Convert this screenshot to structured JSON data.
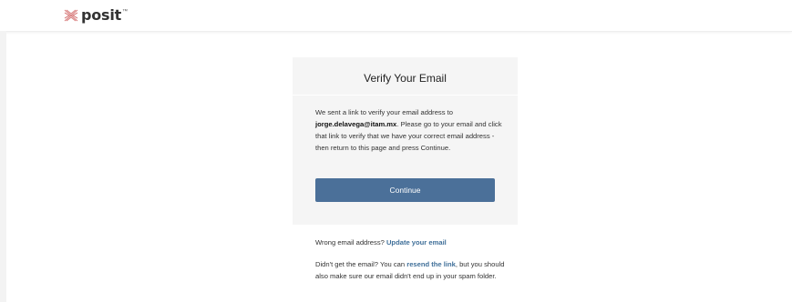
{
  "header": {
    "logo_text": "posit",
    "logo_mark": "™"
  },
  "card": {
    "title": "Verify Your Email",
    "body_prefix": "We sent a link to verify your email address to ",
    "email": "jorge.delavega@itam.mx",
    "body_suffix": ". Please go to your email and click that link to verify that we have your correct email address - then return to this page and press Continue.",
    "continue_label": "Continue"
  },
  "wrong_email": {
    "text": "Wrong email address? ",
    "link_label": "Update your email"
  },
  "resend": {
    "text_before": "Didn't get the email? You can ",
    "link_label": "resend the link",
    "text_after": ", but you should also make sure our email didn't end up in your spam folder."
  },
  "colors": {
    "button": "#4b7099",
    "link": "#3f6f99",
    "card_bg": "#f5f5f5",
    "logo_accent": "#e07a7a"
  },
  "icons": {
    "logo": "posit-logo-icon"
  }
}
